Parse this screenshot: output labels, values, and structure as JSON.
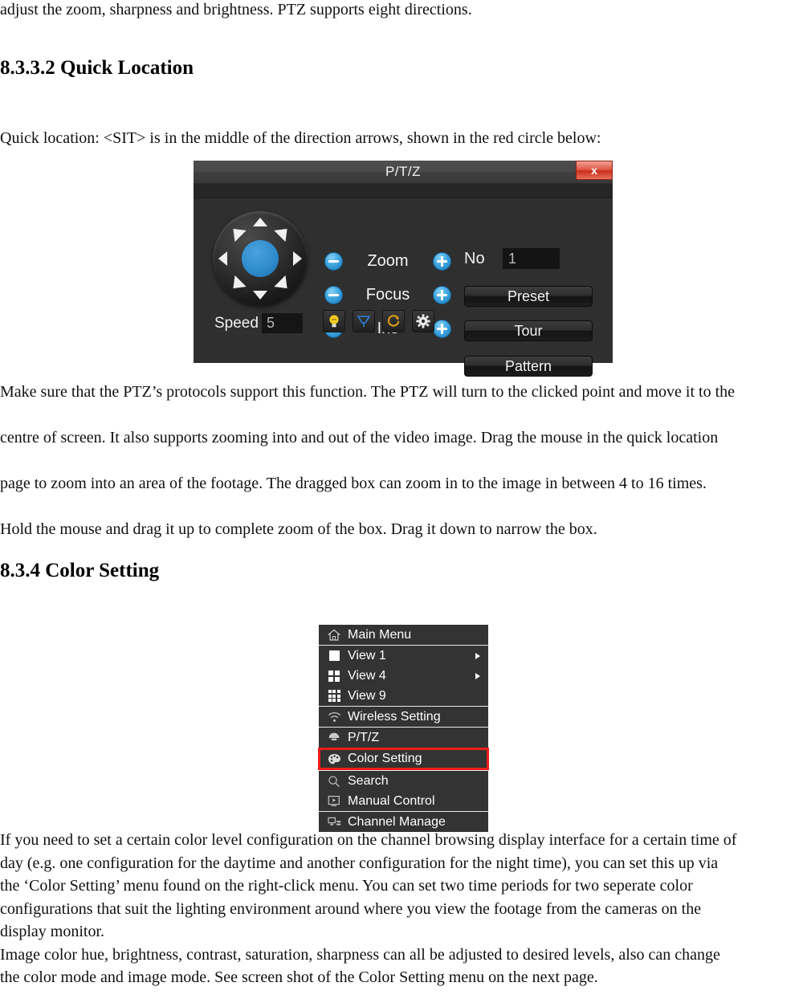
{
  "document": {
    "intro_line": "adjust the zoom, sharpness and brightness. PTZ supports eight directions.",
    "heading_quick_location": "8.3.3.2 Quick Location",
    "quick_location_lead": "Quick location: <SIT> is in the middle of the direction arrows, shown in the red circle below:",
    "para_after_ptz": {
      "l1": "Make sure that the PTZ’s protocols support this function. The PTZ will turn to the clicked point and move it to the",
      "l2": "centre of screen. It also supports zooming into and out of the video image. Drag the mouse in the quick location",
      "l3": "page to zoom into an area of the footage. The dragged box can zoom in to the image in between 4 to 16 times.",
      "l4": "Hold the mouse and drag it up to complete zoom of the box. Drag it down to narrow the box."
    },
    "heading_color_setting": "8.3.4  Color Setting",
    "para_color_setting": {
      "l1": "If you need to set a certain color level configuration on the channel browsing display interface for a certain time of",
      "l2": "day (e.g. one configuration for the daytime and another configuration for the night time), you can set this up via",
      "l3": "the ‘Color Setting’ menu found on the right-click menu. You can set two time periods for two seperate color",
      "l4": "configurations that suit the lighting environment around where you view the footage from the cameras on the",
      "l5": "display monitor.",
      "l6": "Image color hue, brightness, contrast, saturation, sharpness can all be adjusted to desired levels, also can change",
      "l7": "the color mode and image mode. See screen shot of the Color Setting menu on the next page."
    }
  },
  "ptz_dialog": {
    "title": "P/T/Z",
    "close_label": "x",
    "speed": {
      "label": "Speed",
      "value": "5"
    },
    "controls": [
      {
        "label": "Zoom",
        "minus": "−",
        "plus": "+"
      },
      {
        "label": "Focus",
        "minus": "−",
        "plus": "+"
      },
      {
        "label": "Iris",
        "minus": "−",
        "plus": "+"
      }
    ],
    "no_field": {
      "label": "No",
      "value": "1"
    },
    "buttons": [
      {
        "label": "Preset"
      },
      {
        "label": "Tour"
      },
      {
        "label": "Pattern"
      }
    ],
    "aux_icons": [
      {
        "name": "light-bulb-icon",
        "color": "#f2c218"
      },
      {
        "name": "wiper-icon",
        "color": "#2f7fd6"
      },
      {
        "name": "auto-rotate-icon",
        "color": "#d69a1a"
      },
      {
        "name": "gear-icon",
        "color": "#e8e8e8"
      }
    ],
    "joystick": {
      "directions": [
        "up",
        "up-right",
        "right",
        "down-right",
        "down",
        "down-left",
        "left",
        "up-left"
      ],
      "center": "SIT",
      "center_color": "#2f8ccd"
    },
    "colors": {
      "panel_bg": "#2f2f2f",
      "titlebar": "#474747",
      "close_red": "#d8412b",
      "accent_blue": "#3fa6e0"
    }
  },
  "context_menu": {
    "highlight_color": "#ef1c1c",
    "groups": [
      {
        "items": [
          {
            "icon": "home-icon",
            "label": "Main Menu",
            "submenu": false,
            "highlighted": false
          }
        ]
      },
      {
        "items": [
          {
            "icon": "view-1-icon",
            "label": "View 1",
            "submenu": true,
            "highlighted": false
          },
          {
            "icon": "view-4-icon",
            "label": "View 4",
            "submenu": true,
            "highlighted": false
          },
          {
            "icon": "view-9-icon",
            "label": "View 9",
            "submenu": false,
            "highlighted": false
          }
        ]
      },
      {
        "items": [
          {
            "icon": "wifi-icon",
            "label": "Wireless Setting",
            "submenu": false,
            "highlighted": false
          }
        ]
      },
      {
        "items": [
          {
            "icon": "dome-camera-icon",
            "label": "P/T/Z",
            "submenu": false,
            "highlighted": false
          },
          {
            "icon": "palette-icon",
            "label": "Color Setting",
            "submenu": false,
            "highlighted": true
          }
        ]
      },
      {
        "items": [
          {
            "icon": "search-icon",
            "label": "Search",
            "submenu": false,
            "highlighted": false
          },
          {
            "icon": "manual-control-icon",
            "label": "Manual Control",
            "submenu": false,
            "highlighted": false
          }
        ]
      },
      {
        "items": [
          {
            "icon": "channel-manage-icon",
            "label": "Channel Manage",
            "submenu": false,
            "highlighted": false
          }
        ]
      }
    ]
  }
}
